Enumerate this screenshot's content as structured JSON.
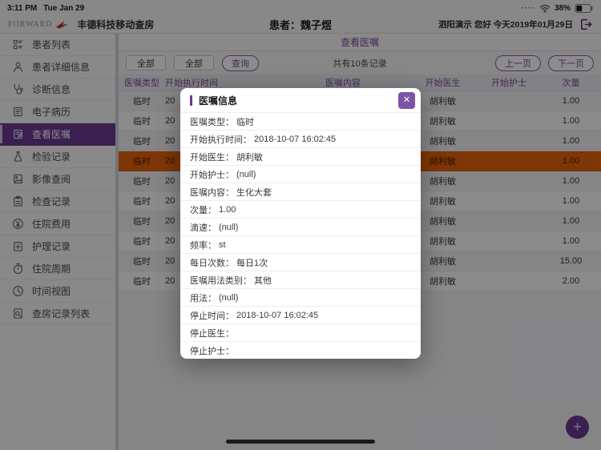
{
  "statusbar": {
    "time": "3:11 PM",
    "date": "Tue Jan 29",
    "battery": "38%"
  },
  "header": {
    "logo": "FORWARD",
    "app_name": "丰德科技移动查房",
    "patient_title": "患者：魏子煜",
    "greeting": "泗阳演示 您好 今天2019年01月29日"
  },
  "sidebar": {
    "items": [
      {
        "icon": "patient-list",
        "label": "患者列表",
        "selected": false
      },
      {
        "icon": "patient-detail",
        "label": "患者详细信息",
        "selected": false
      },
      {
        "icon": "diagnosis",
        "label": "诊断信息",
        "selected": false
      },
      {
        "icon": "emr",
        "label": "电子病历",
        "selected": false
      },
      {
        "icon": "orders",
        "label": "查看医嘱",
        "selected": true
      },
      {
        "icon": "lab",
        "label": "检验记录",
        "selected": false
      },
      {
        "icon": "imaging",
        "label": "影像查阅",
        "selected": false
      },
      {
        "icon": "exam",
        "label": "检查记录",
        "selected": false
      },
      {
        "icon": "cost",
        "label": "住院费用",
        "selected": false
      },
      {
        "icon": "nursing",
        "label": "护理记录",
        "selected": false
      },
      {
        "icon": "cycle",
        "label": "住院周期",
        "selected": false
      },
      {
        "icon": "timeview",
        "label": "时间视图",
        "selected": false
      },
      {
        "icon": "rounds",
        "label": "查房记录列表",
        "selected": false
      }
    ]
  },
  "orders": {
    "page_title": "查看医嘱",
    "filters": {
      "all1": "全部",
      "all2": "全部",
      "query": "查询"
    },
    "record_count": "共有10条记录",
    "pager": {
      "prev": "上一页",
      "next": "下一页"
    },
    "columns": [
      "医嘱类型",
      "开始执行时间",
      "医嘱内容",
      "开始医生",
      "开始护士",
      "次量"
    ],
    "rows": [
      {
        "type": "临时",
        "time": "20",
        "content": "",
        "doctor": "胡利敏",
        "nurse": "",
        "dose": "1.00",
        "selected": false
      },
      {
        "type": "临时",
        "time": "20",
        "content": "",
        "doctor": "胡利敏",
        "nurse": "",
        "dose": "1.00",
        "selected": false
      },
      {
        "type": "临时",
        "time": "20",
        "content": "",
        "doctor": "胡利敏",
        "nurse": "",
        "dose": "1.00",
        "selected": false
      },
      {
        "type": "临时",
        "time": "20",
        "content": "",
        "doctor": "胡利敏",
        "nurse": "",
        "dose": "1.00",
        "selected": true
      },
      {
        "type": "临时",
        "time": "20",
        "content": "",
        "doctor": "胡利敏",
        "nurse": "",
        "dose": "1.00",
        "selected": false
      },
      {
        "type": "临时",
        "time": "20",
        "content": "",
        "doctor": "胡利敏",
        "nurse": "",
        "dose": "1.00",
        "selected": false
      },
      {
        "type": "临时",
        "time": "20",
        "content": "",
        "doctor": "胡利敏",
        "nurse": "",
        "dose": "1.00",
        "selected": false
      },
      {
        "type": "临时",
        "time": "20",
        "content": "",
        "doctor": "胡利敏",
        "nurse": "",
        "dose": "1.00",
        "selected": false
      },
      {
        "type": "临时",
        "time": "20",
        "content": "",
        "doctor": "胡利敏",
        "nurse": "",
        "dose": "15.00",
        "selected": false
      },
      {
        "type": "临时",
        "time": "20",
        "content": "",
        "doctor": "胡利敏",
        "nurse": "",
        "dose": "2.00",
        "selected": false
      }
    ]
  },
  "modal": {
    "title": "医嘱信息",
    "close_icon": "✕",
    "fields": [
      {
        "label": "医嘱类型",
        "value": "临时"
      },
      {
        "label": "开始执行时间",
        "value": "2018-10-07 16:02:45"
      },
      {
        "label": "开始医生",
        "value": "胡利敏"
      },
      {
        "label": "开始护士",
        "value": "(null)"
      },
      {
        "label": "医嘱内容",
        "value": "生化大套"
      },
      {
        "label": "次量",
        "value": "1.00"
      },
      {
        "label": "滴速",
        "value": "(null)"
      },
      {
        "label": "频率",
        "value": "st"
      },
      {
        "label": "每日次数",
        "value": "每日1次"
      },
      {
        "label": "医嘱用法类别",
        "value": "其他"
      },
      {
        "label": "用法",
        "value": "(null)"
      },
      {
        "label": "停止时间",
        "value": "2018-10-07 16:02:45"
      },
      {
        "label": "停止医生",
        "value": ""
      },
      {
        "label": "停止护士",
        "value": ""
      }
    ]
  },
  "fab": {
    "label": "+"
  },
  "colors": {
    "primary_purple": "#7A4C9E",
    "deep_purple": "#6B3A92",
    "selected_row_orange": "#E8630D",
    "modal_close_purple": "#7D55A8"
  }
}
